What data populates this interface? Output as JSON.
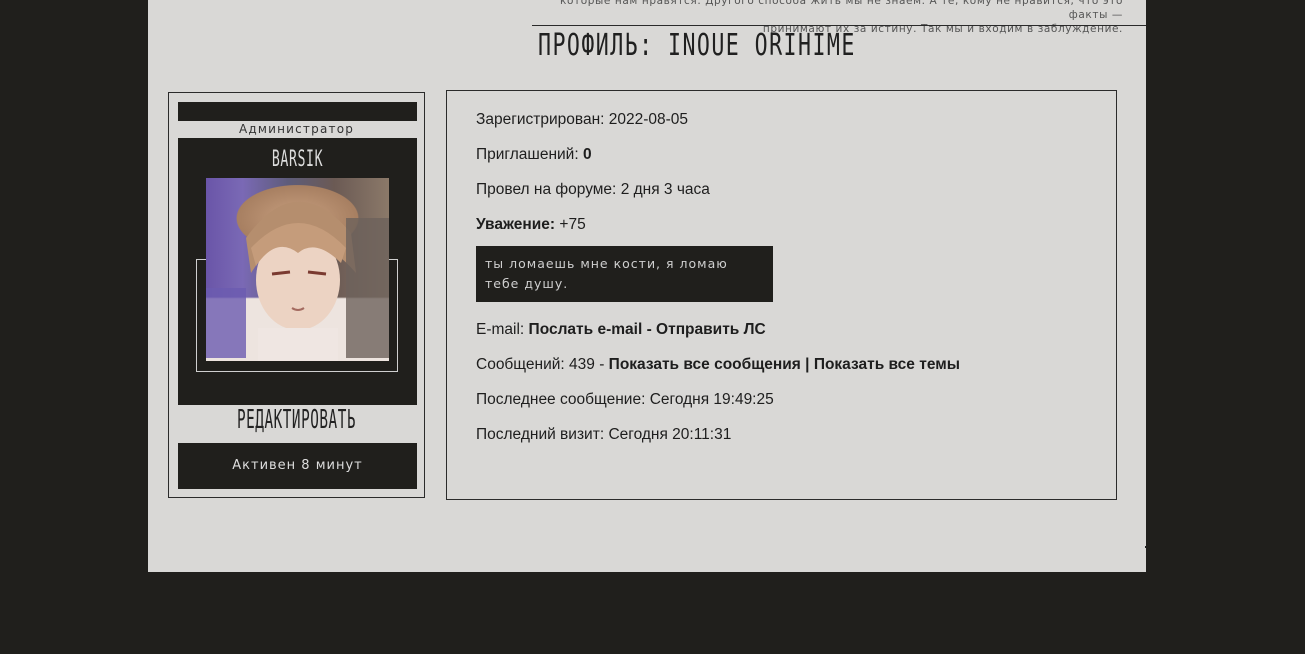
{
  "header": {
    "quote_line1": "которые нам нравятся. Другого способа жить мы не знаем. А те, кому не нравится, что это факты —",
    "quote_line2": "принимают их за истину. Так мы и входим в заблуждение.",
    "title": "ПРОФИЛЬ: INOUE ORIHIME"
  },
  "sidebar": {
    "group": "Администратор",
    "nickname": "BARSIK",
    "edit_label": "РЕДАКТИРОВАТЬ",
    "status": "Активен 8 минут"
  },
  "info": {
    "registered_label": "Зарегистрирован:",
    "registered_value": "2022-08-05",
    "invites_label": "Приглашений:",
    "invites_value": "0",
    "time_label": "Провел на форуме:",
    "time_value": "2 дня 3 часа",
    "respect_label": "Уважение:",
    "respect_value": "+75",
    "status_quote": "ты ломаешь мне кости, я ломаю тебе душу.",
    "email_label": "E-mail:",
    "email_link": "Послать e-mail",
    "email_sep": " - ",
    "pm_link": "Отправить ЛС",
    "posts_label": "Сообщений:",
    "posts_value": "439",
    "posts_sep": " - ",
    "all_posts_link": "Показать все сообщения",
    "link_sep": " | ",
    "all_topics_link": "Показать все темы",
    "last_post_label": "Последнее сообщение:",
    "last_post_value": "Сегодня 19:49:25",
    "last_visit_label": "Последний визит:",
    "last_visit_value": "Сегодня 20:11:31"
  }
}
